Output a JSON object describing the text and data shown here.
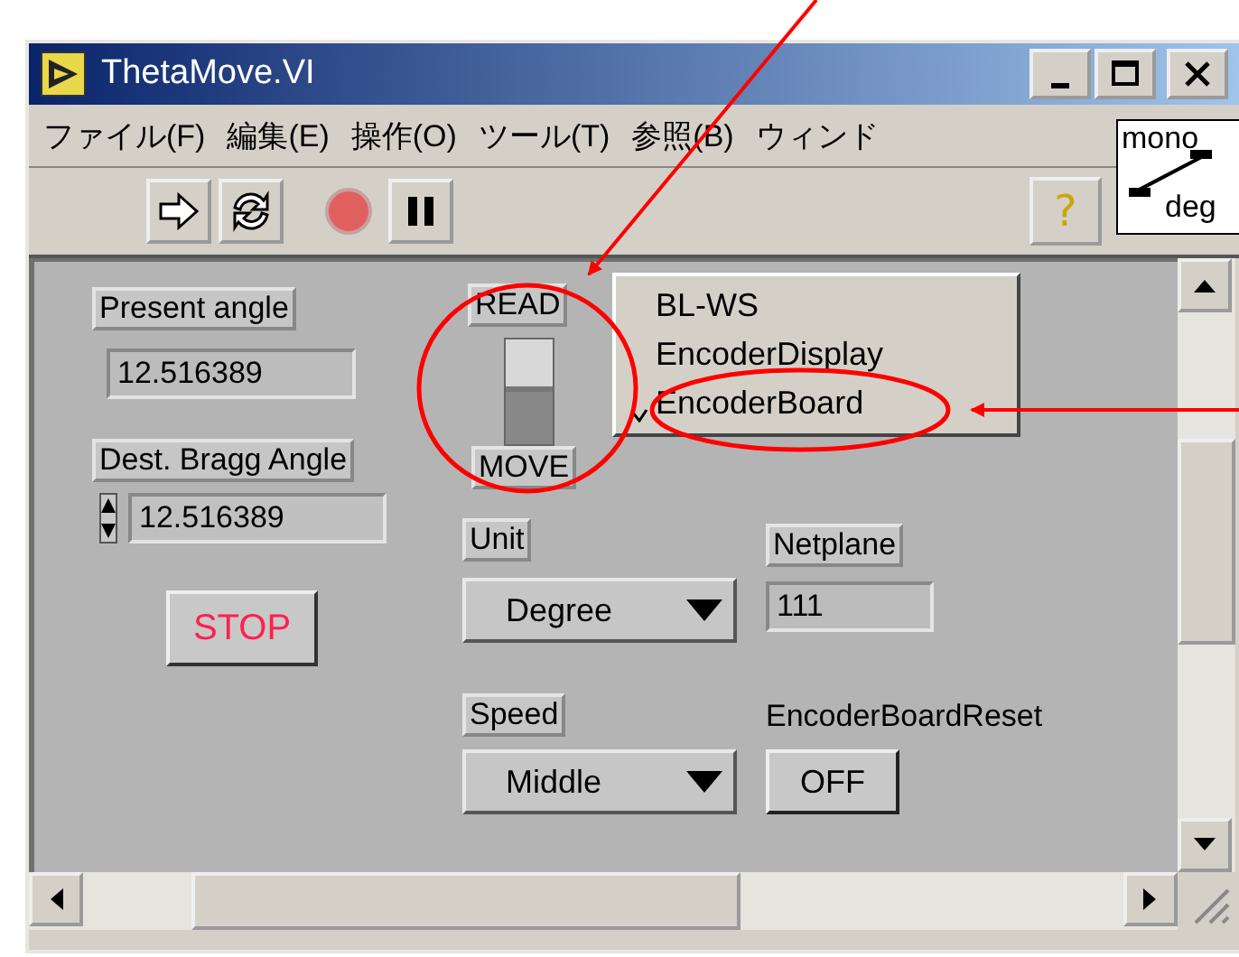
{
  "window": {
    "title": "ThetaMove.VI"
  },
  "menu": [
    {
      "label": "ファイル(F)"
    },
    {
      "label": "編集(E)"
    },
    {
      "label": "操作(O)"
    },
    {
      "label": "ツール(T)"
    },
    {
      "label": "参照(B)"
    },
    {
      "label": "ウィンド"
    }
  ],
  "toolbar": {
    "help_button": "?"
  },
  "connector_pane": {
    "top": "mono",
    "bottom": "deg"
  },
  "panel": {
    "present_angle": {
      "label": "Present angle",
      "value": "12.516389"
    },
    "dest_bragg_angle": {
      "label": "Dest. Bragg Angle",
      "value": "12.516389"
    },
    "stop_button": "STOP",
    "switch": {
      "top_label": "READ",
      "bottom_label": "MOVE",
      "thumb_up": true
    },
    "popup_menu": [
      {
        "label": "BL-WS",
        "checked": false
      },
      {
        "label": "EncoderDisplay",
        "checked": false
      },
      {
        "label": "EncoderBoard",
        "checked": true
      }
    ],
    "unit": {
      "label": "Unit",
      "value": "Degree"
    },
    "netplane": {
      "label": "Netplane",
      "value": "111"
    },
    "speed": {
      "label": "Speed",
      "value": "Middle"
    },
    "encoder_board_reset": {
      "label": "EncoderBoardReset",
      "button": "OFF"
    }
  }
}
